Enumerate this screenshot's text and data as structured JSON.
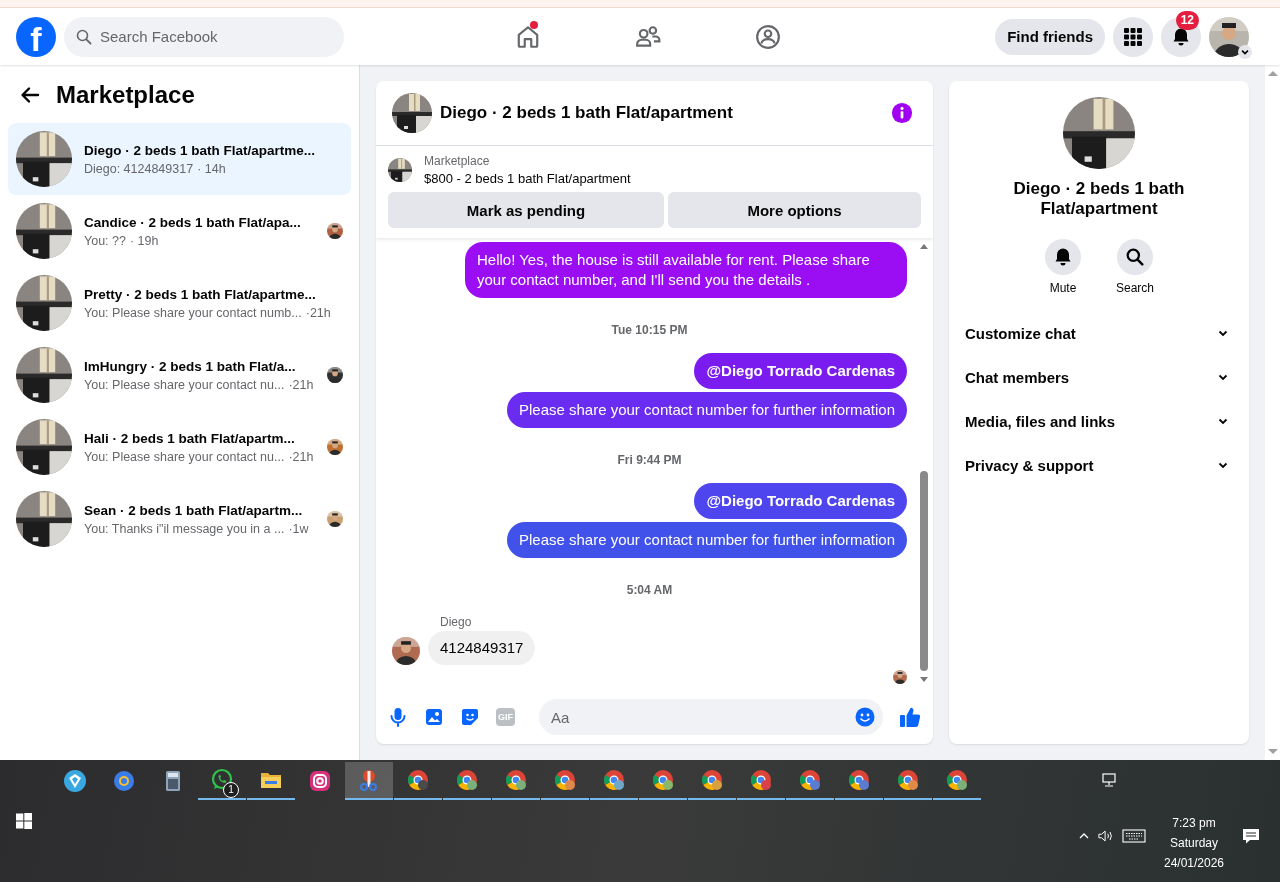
{
  "header": {
    "logo_letter": "f",
    "search": {
      "placeholder": "Search Facebook"
    },
    "home_dot": true,
    "find_friends": "Find friends",
    "notification_count": "12"
  },
  "sidebar": {
    "title": "Marketplace",
    "conversations": [
      {
        "title": "Diego · 2 beds 1 bath Flat/apartme...",
        "preview": "Diego: 4124849317",
        "time": "· 14h",
        "selected": true,
        "seen": false
      },
      {
        "title": "Candice · 2 beds 1 bath Flat/apa...",
        "preview": "You: ??",
        "time": "· 19h",
        "selected": false,
        "seen": true
      },
      {
        "title": "Pretty · 2 beds 1 bath Flat/apartme...",
        "preview": "You: Please share your contact numb...",
        "time": "·21h",
        "selected": false,
        "seen": false
      },
      {
        "title": "ImHungry · 2 beds 1 bath Flat/a...",
        "preview": "You: Please share your contact nu...",
        "time": "·21h",
        "selected": false,
        "seen": true
      },
      {
        "title": "Hali · 2 beds 1 bath Flat/apartm...",
        "preview": "You: Please share your contact nu...",
        "time": "·21h",
        "selected": false,
        "seen": true
      },
      {
        "title": "Sean · 2 beds 1 bath Flat/apartm...",
        "preview": "You: Thanks i\"il message you in a ...",
        "time": "·1w",
        "selected": false,
        "seen": true
      }
    ]
  },
  "chat": {
    "title": "Diego · 2 beds 1 bath Flat/apartment",
    "listing": {
      "label": "Marketplace",
      "name": "$800 - 2 beds 1 bath Flat/apartment"
    },
    "actions": [
      "Mark as pending",
      "More options"
    ],
    "messages": [
      {
        "kind": "outgoing",
        "text": "Hello! Yes, the house is still available for rent. Please share your contact number, and I'll send you the details .",
        "color": "#9b0df2",
        "mention": false
      },
      {
        "kind": "timestamp",
        "text": "Tue 10:15 PM"
      },
      {
        "kind": "outgoing",
        "text": "@Diego Torrado Cardenas",
        "color": "#7a1cf0",
        "mention": true
      },
      {
        "kind": "outgoing",
        "text": "Please share your contact number for further information",
        "color": "#6a2cf0",
        "mention": false
      },
      {
        "kind": "timestamp",
        "text": "Fri 9:44 PM"
      },
      {
        "kind": "outgoing",
        "text": "@Diego Torrado Cardenas",
        "color": "#4f45ef",
        "mention": true
      },
      {
        "kind": "outgoing",
        "text": "Please share your contact number for further information",
        "color": "#4152ea",
        "mention": false
      },
      {
        "kind": "timestamp",
        "text": "5:04 AM"
      },
      {
        "kind": "incoming",
        "sender": "Diego",
        "text": "4124849317"
      }
    ],
    "seen_by_recipient": true,
    "composer": {
      "gif_label": "GIF",
      "placeholder": "Aa"
    }
  },
  "details": {
    "title": "Diego · 2 beds 1 bath Flat/apartment",
    "actions": [
      {
        "kind": "mute",
        "label": "Mute"
      },
      {
        "kind": "search",
        "label": "Search"
      }
    ],
    "sections": [
      {
        "label": "Customize chat",
        "expanded": false
      },
      {
        "label": "Chat members",
        "expanded": false
      },
      {
        "label": "Media, files and links",
        "expanded": false
      },
      {
        "label": "Privacy & support",
        "expanded": false
      }
    ]
  },
  "taskbar": {
    "apps": [
      {
        "kind": "store",
        "running": false,
        "selected": false
      },
      {
        "kind": "browser",
        "running": false,
        "selected": false
      },
      {
        "kind": "calculator",
        "running": false,
        "selected": false
      },
      {
        "kind": "whatsapp",
        "running": true,
        "selected": false,
        "badge": "1"
      },
      {
        "kind": "folder",
        "running": true,
        "selected": false
      },
      {
        "kind": "instagram",
        "running": false,
        "selected": false
      },
      {
        "kind": "tool",
        "running": true,
        "selected": true
      },
      {
        "kind": "chrome",
        "running": true,
        "selected": false,
        "color": "#4a4a4a"
      },
      {
        "kind": "chrome",
        "running": true,
        "selected": false,
        "color": "#7bb07a"
      },
      {
        "kind": "chrome",
        "running": true,
        "selected": false,
        "color": "#7bb07a"
      },
      {
        "kind": "chrome",
        "running": true,
        "selected": false,
        "color": "#e08a4a"
      },
      {
        "kind": "chrome",
        "running": true,
        "selected": false,
        "color": "#6fa8c8"
      },
      {
        "kind": "chrome",
        "running": true,
        "selected": false,
        "color": "#8ab86a"
      },
      {
        "kind": "chrome",
        "running": true,
        "selected": false,
        "color": "#d9a040"
      },
      {
        "kind": "chrome",
        "running": true,
        "selected": false,
        "color": "#d9414a"
      },
      {
        "kind": "chrome",
        "running": true,
        "selected": false,
        "color": "#5a7bd0"
      },
      {
        "kind": "chrome",
        "running": true,
        "selected": false,
        "color": "#5a7bd0"
      },
      {
        "kind": "chrome",
        "running": true,
        "selected": false,
        "color": "#e08a4a"
      },
      {
        "kind": "chrome",
        "running": true,
        "selected": false,
        "color": "#7bb07a"
      }
    ],
    "clock": {
      "time": "7:23 pm",
      "day": "Saturday",
      "date": "24/01/2026"
    }
  }
}
